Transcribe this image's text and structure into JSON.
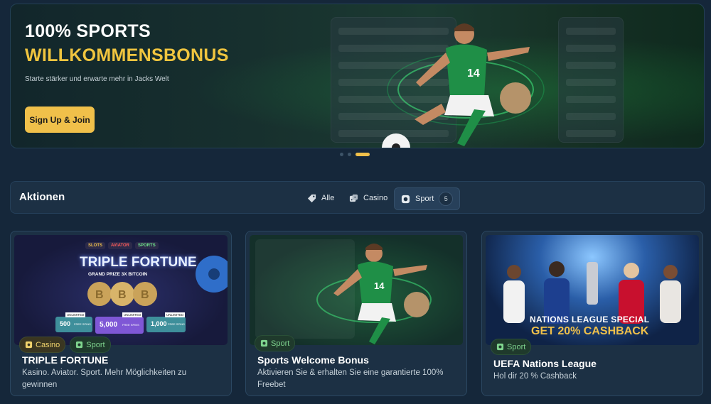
{
  "hero": {
    "title_line1": "100% SPORTS",
    "title_line2": "WILLKOMMENSBONUS",
    "subtitle": "Starte stärker und erwarte mehr in Jacks Welt",
    "cta_label": "Sign Up & Join",
    "player_number": "14",
    "carousel_active_index": 3,
    "carousel_count": 3
  },
  "promotions": {
    "title": "Aktionen",
    "tabs": [
      {
        "label": "Alle",
        "icon": "tag-icon"
      },
      {
        "label": "Casino",
        "icon": "dice-icon"
      },
      {
        "label": "Sport",
        "icon": "ball-icon",
        "count": "5",
        "active": true
      }
    ]
  },
  "cards": [
    {
      "badges": [
        {
          "label": "Casino",
          "icon": "casino-icon"
        },
        {
          "label": "Sport",
          "icon": "sport-icon"
        }
      ],
      "title": "TRIPLE FORTUNE",
      "description": "Kasino. Aviator. Sport. Mehr Möglichkeiten zu gewinnen",
      "image": {
        "tags": [
          "SLOTS",
          "AVIATOR",
          "SPORTS"
        ],
        "headline": "TRIPLE FORTUNE",
        "sub": "GRAND PRIZE 3X BITCOIN",
        "tickets": [
          {
            "top": "UNLIMITED",
            "value": "500",
            "label": "FREE SPINS"
          },
          {
            "top": "UNLIMITED",
            "value": "5,000",
            "label": "FREE SPINS"
          },
          {
            "top": "UNLIMITED",
            "value": "1,000",
            "label": "FREE SPINS"
          }
        ]
      }
    },
    {
      "badges": [
        {
          "label": "Sport",
          "icon": "sport-icon"
        }
      ],
      "title": "Sports Welcome Bonus",
      "description": "Aktivieren Sie & erhalten Sie eine garantierte 100% Freebet",
      "image": {
        "player_number": "14"
      }
    },
    {
      "badges": [
        {
          "label": "Sport",
          "icon": "sport-icon"
        }
      ],
      "title": "UEFA Nations League",
      "description": "Hol dir 20 % Cashback",
      "image": {
        "line1": "NATIONS LEAGUE SPECIAL",
        "line2": "GET 20% CASHBACK"
      }
    }
  ],
  "colors": {
    "accent": "#f0c04a",
    "background": "#15273a",
    "panel": "#1c3044",
    "sport_green": "#7fd48e"
  }
}
